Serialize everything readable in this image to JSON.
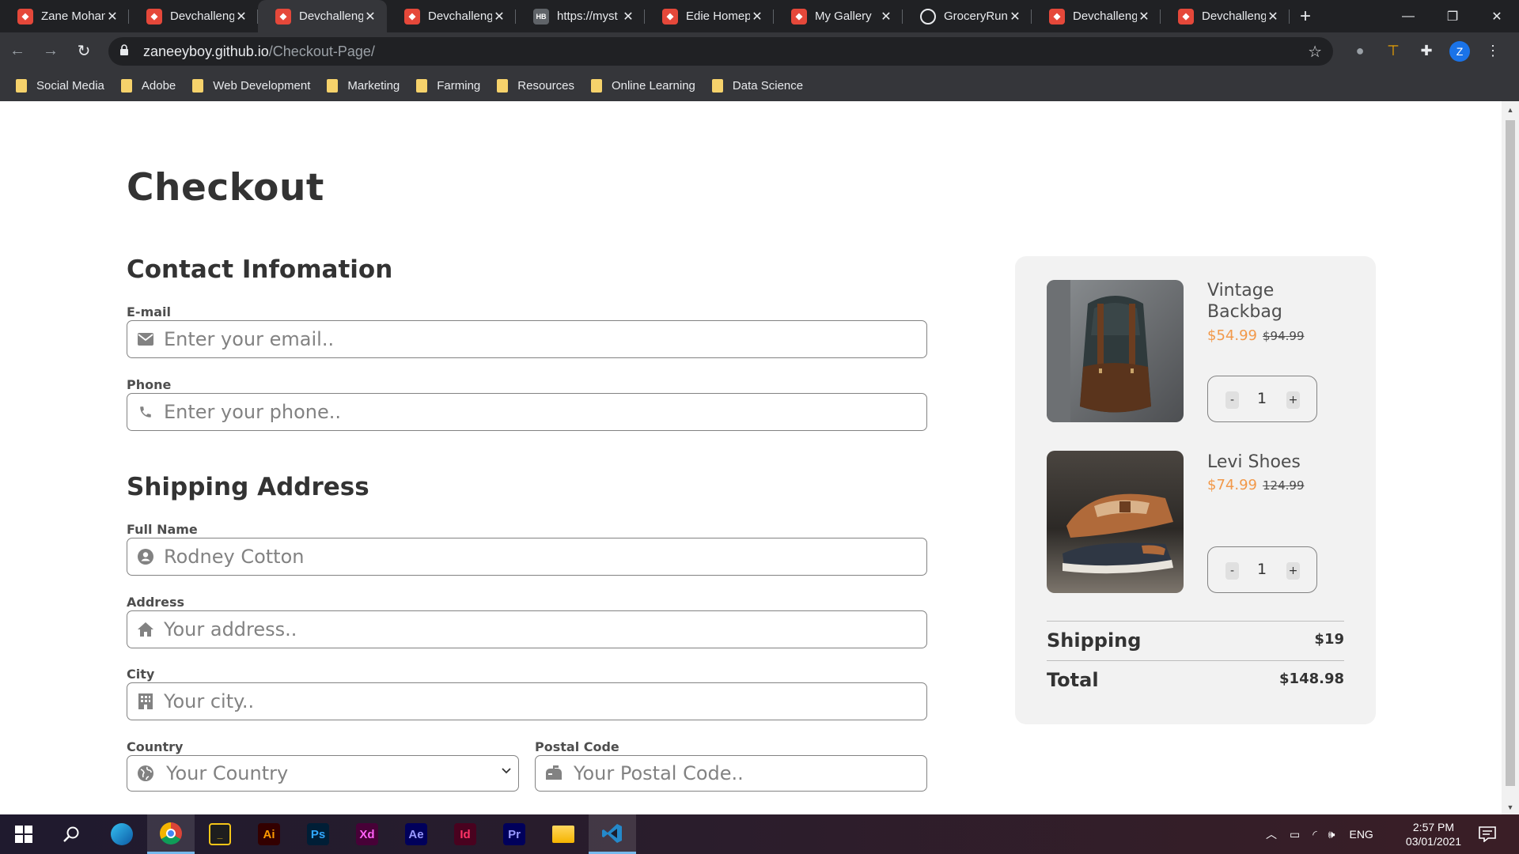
{
  "browser": {
    "tabs": [
      {
        "title": "Zane Mohan",
        "icon": "codepen-red-icon"
      },
      {
        "title": "Devchallenges",
        "icon": "devchallenges-icon"
      },
      {
        "title": "Devchallenges",
        "icon": "devchallenges-icon",
        "active": true
      },
      {
        "title": "Devchallenges",
        "icon": "devchallenges-icon"
      },
      {
        "title": "https://myst",
        "icon": "hb-icon"
      },
      {
        "title": "Edie Homepage",
        "icon": "devchallenges-icon"
      },
      {
        "title": "My Gallery",
        "icon": "devchallenges-icon"
      },
      {
        "title": "GroceryRun",
        "icon": "globe-icon"
      },
      {
        "title": "Devchallenges",
        "icon": "devchallenges-icon"
      },
      {
        "title": "Devchallenges",
        "icon": "devchallenges-icon"
      }
    ],
    "url_domain": "zaneeyboy.github.io",
    "url_path": "/Checkout-Page/",
    "profile_initial": "Z",
    "bookmarks": [
      "Social Media",
      "Adobe",
      "Web Development",
      "Marketing",
      "Farming",
      "Resources",
      "Online Learning",
      "Data Science"
    ]
  },
  "page": {
    "title": "Checkout",
    "contact": {
      "heading": "Contact Infomation",
      "email_label": "E-mail",
      "email_placeholder": "Enter your email..",
      "phone_label": "Phone",
      "phone_placeholder": "Enter your phone.."
    },
    "shipping": {
      "heading": "Shipping Address",
      "fullname_label": "Full Name",
      "fullname_value": "Rodney Cotton",
      "address_label": "Address",
      "address_placeholder": "Your address..",
      "city_label": "City",
      "city_placeholder": "Your city..",
      "country_label": "Country",
      "country_selected": "Your Country",
      "postal_label": "Postal Code",
      "postal_placeholder": "Your Postal Code.."
    },
    "summary": {
      "items": [
        {
          "name": "Vintage Backbag",
          "price": "$54.99",
          "old_price": "$94.99",
          "qty": "1"
        },
        {
          "name": "Levi Shoes",
          "price": "$74.99",
          "old_price": "124.99",
          "qty": "1"
        }
      ],
      "minus": "-",
      "plus": "+",
      "shipping_label": "Shipping",
      "shipping_value": "$19",
      "total_label": "Total",
      "total_value": "$148.98"
    },
    "colors": {
      "accent_price": "#f2994a",
      "panel_bg": "#f2f2f2",
      "border": "#828282"
    }
  },
  "taskbar": {
    "apps": [
      {
        "label": "",
        "name": "edge-icon"
      },
      {
        "label": "",
        "name": "chrome-icon"
      },
      {
        "label": "",
        "name": "terminal-icon"
      },
      {
        "label": "Ai",
        "name": "illustrator-icon"
      },
      {
        "label": "Ps",
        "name": "photoshop-icon"
      },
      {
        "label": "Xd",
        "name": "xd-icon"
      },
      {
        "label": "Ae",
        "name": "after-effects-icon"
      },
      {
        "label": "Id",
        "name": "indesign-icon"
      },
      {
        "label": "Pr",
        "name": "premiere-icon"
      },
      {
        "label": "",
        "name": "file-explorer-icon"
      },
      {
        "label": "",
        "name": "vscode-icon"
      }
    ],
    "language": "ENG",
    "time": "2:57 PM",
    "date": "03/01/2021"
  }
}
